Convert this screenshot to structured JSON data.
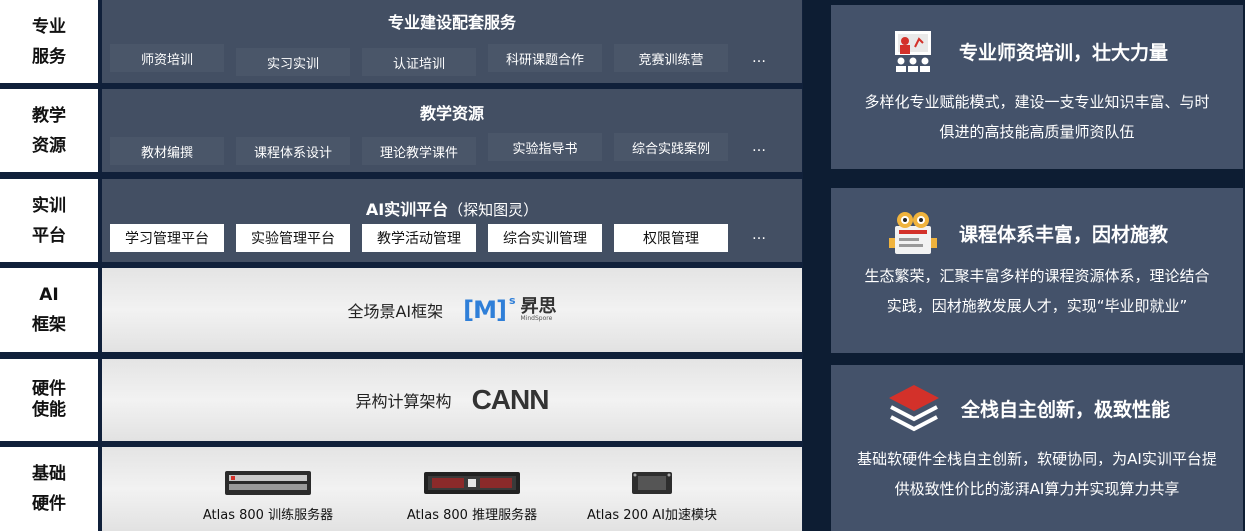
{
  "rows": {
    "service": {
      "label_line1": "专业",
      "label_line2": "服务",
      "title": "专业建设配套服务",
      "items": [
        "师资培训",
        "实习实训",
        "认证培训",
        "科研课题合作",
        "竞赛训练营"
      ],
      "more": "…"
    },
    "resources": {
      "label_line1": "教学",
      "label_line2": "资源",
      "title": "教学资源",
      "items": [
        "教材编撰",
        "课程体系设计",
        "理论教学课件",
        "实验指导书",
        "综合实践案例"
      ],
      "more": "…"
    },
    "platform": {
      "label_line1": "实训",
      "label_line2": "平台",
      "title": "AI实训平台",
      "title_sub": "（探知图灵）",
      "items": [
        "学习管理平台",
        "实验管理平台",
        "教学活动管理",
        "综合实训管理",
        "权限管理"
      ],
      "more": "…"
    },
    "framework": {
      "label_line1": "AI",
      "label_line2": "框架",
      "text": "全场景AI框架",
      "logo_mark": "[M]",
      "logo_sup": "s",
      "logo_cn": "昇思",
      "logo_en": "MindSpore"
    },
    "hardware_enable": {
      "label_line1": "硬件",
      "label_line2": "使能",
      "text": "异构计算架构",
      "logo": "CANN"
    },
    "hardware": {
      "label_line1": "基础",
      "label_line2": "硬件",
      "items": [
        "Atlas 800 训练服务器",
        "Atlas 800 推理服务器",
        "Atlas 200 AI加速模块"
      ]
    }
  },
  "cards": [
    {
      "icon": "teacher-board-icon",
      "title": "专业师资培训，壮大力量",
      "desc_line1": "多样化专业赋能模式，建设一支专业知识丰富、与时",
      "desc_line2": "俱进的高技能高质量师资队伍"
    },
    {
      "icon": "robot-book-icon",
      "title": "课程体系丰富，因材施教",
      "desc_line1": "生态繁荣，汇聚丰富多样的课程资源体系，理论结合",
      "desc_line2": "实践，因材施教发展人才，实现“毕业即就业”"
    },
    {
      "icon": "layers-stack-icon",
      "title": "全栈自主创新，极致性能",
      "desc_line1": "基础软硬件全栈自主创新，软硬协同，为AI实训平台提",
      "desc_line2": "供极致性价比的澎湃AI算力并实现算力共享"
    }
  ],
  "colors": {
    "dark_panel": "#434f63",
    "card_bg": "#44526a",
    "accent_red": "#d3312a",
    "mindspore_blue": "#2f7fd8"
  }
}
